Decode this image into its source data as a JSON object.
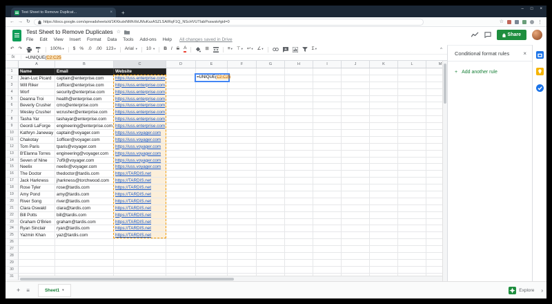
{
  "window": {
    "minimize": "–",
    "maximize": "□",
    "close": "×"
  },
  "browser": {
    "tab_title": "Test Sheet to Remove Duplicat...",
    "new_tab": "+",
    "url": "https://docs.google.com/spreadsheets/d/1KKkutxNMhXkUMuKszASZLSAIRqF1Q_NScHVUTIabPsswsk#gid=0"
  },
  "icons": {
    "back": "←",
    "forward": "→",
    "reload": "↻",
    "menu_dots": "⋮",
    "undo": "↶",
    "redo": "↷",
    "caret": "▾",
    "close": "×",
    "plus": "+",
    "collapse": "^",
    "star": "☆",
    "hamburger": "≡",
    "chevron_right": "›",
    "borders": "⊞",
    "align": "≡",
    "valign": "⊤",
    "wrap": "↩",
    "rotate": "∠"
  },
  "header": {
    "title": "Test Sheet to Remove Duplicates",
    "menus": [
      "File",
      "Edit",
      "View",
      "Insert",
      "Format",
      "Data",
      "Tools",
      "Add-ons",
      "Help"
    ],
    "saved_status": "All changes saved in Drive",
    "share_label": "Share"
  },
  "toolbar": {
    "zoom": "100%",
    "currency": "$",
    "percent": "%",
    "dec_decrease": ".0",
    "dec_increase": ".00",
    "more_formats": "123",
    "font": "Arial",
    "font_size": "10",
    "bold": "B",
    "italic": "I",
    "strikethrough": "S",
    "text_color": "A",
    "functions": "Σ"
  },
  "formula_bar": {
    "fx": "fx",
    "prefix": "=UNIQUE(",
    "range": "C2:C25"
  },
  "sheet": {
    "col_letters": [
      "A",
      "B",
      "C",
      "D",
      "E",
      "F",
      "G",
      "H",
      "I",
      "J",
      "K",
      "L",
      "M"
    ],
    "num_rows_visible": 31,
    "header_row": [
      "Name",
      "Email",
      "Website"
    ],
    "rows": [
      {
        "name": "Jean-Luc Picard",
        "email": "captain@enterprise.com",
        "website": "https://uss.enterprise.com"
      },
      {
        "name": "Will Riker",
        "email": "1officer@enterprise.com",
        "website": "https://uss.enterprise.com"
      },
      {
        "name": "Worf",
        "email": "security@enterprise.com",
        "website": "https://uss.enterprise.com"
      },
      {
        "name": "Deanna Troi",
        "email": "health@enterprise.com",
        "website": "https://uss.enterprise.com"
      },
      {
        "name": "Beverly Crusher",
        "email": "cmo@enterprise.com",
        "website": "https://uss.enterprise.com"
      },
      {
        "name": "Wesley Crusher",
        "email": "wcrusher@enterprise.com",
        "website": "https://uss.enterprise.com"
      },
      {
        "name": "Tasha Yar",
        "email": "tashayar@enterprise.com",
        "website": "https://uss.enterprise.com"
      },
      {
        "name": "Geordi LaForge",
        "email": "engineering@enterprise.com",
        "website": "https://uss.enterprise.com"
      },
      {
        "name": "Kathryn Janeway",
        "email": "captain@voyager.com",
        "website": "https://uss.voyager.com"
      },
      {
        "name": "Chakotay",
        "email": "1officer@voyager.com",
        "website": "https://uss.voyager.com"
      },
      {
        "name": "Tom Paris",
        "email": "tparis@voyager.com",
        "website": "https://uss.voyager.com"
      },
      {
        "name": "B'Elanna Torres",
        "email": "engineering@voyager.com",
        "website": "https://uss.voyager.com"
      },
      {
        "name": "Seven of Nine",
        "email": "7of9@voyager.com",
        "website": "https://uss.voyager.com"
      },
      {
        "name": "Neelix",
        "email": "neelix@voyager.com",
        "website": "https://uss.voyager.com"
      },
      {
        "name": "The Doctor",
        "email": "thedoctor@tardis.com",
        "website": "https://TARDIS.net"
      },
      {
        "name": "Jack Harkness",
        "email": "jharkness@torchwood.com",
        "website": "https://TARDIS.net"
      },
      {
        "name": "Rose Tyler",
        "email": "rose@tardis.com",
        "website": "https://TARDIS.net"
      },
      {
        "name": "Amy Pond",
        "email": "amy@tardis.com",
        "website": "https://TARDIS.net"
      },
      {
        "name": "River Song",
        "email": "river@tardis.com",
        "website": "https://TARDIS.net"
      },
      {
        "name": "Clara Oswald",
        "email": "clara@tardis.com",
        "website": "https://TARDIS.net"
      },
      {
        "name": "Bill Potts",
        "email": "bill@tardis.com",
        "website": "https://TARDIS.net"
      },
      {
        "name": "Graham O'Brien",
        "email": "graham@tardis.com",
        "website": "https://TARDIS.net"
      },
      {
        "name": "Ryan Sinclair",
        "email": "ryan@tardis.com",
        "website": "https://TARDIS.net"
      },
      {
        "name": "Yazmin Khan",
        "email": "yaz@tardis.com",
        "website": "https://TARDIS.net"
      }
    ],
    "edit_cell": {
      "cell": "E2",
      "prefix": "=UNIQUE(",
      "range": "C2:C25"
    }
  },
  "panel": {
    "title": "Conditional format rules",
    "add_rule": "Add another rule"
  },
  "bottom_bar": {
    "sheet_tab": "Sheet1",
    "explore": "Explore"
  },
  "colors": {
    "accent_green": "#188038",
    "share_green": "#1e8e3e",
    "logo_green": "#0f9d58",
    "link_blue": "#1155cc",
    "editor_blue": "#4285f4",
    "range_orange": "#f29900",
    "range_fill": "#fcefda",
    "table_header_bg": "#212121",
    "tabstrip_bg": "#1b2735"
  }
}
